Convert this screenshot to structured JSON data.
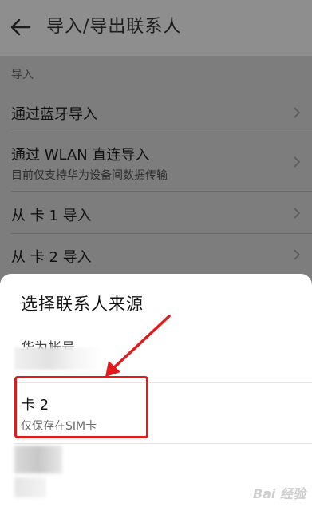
{
  "header": {
    "title": "导入/导出联系人"
  },
  "list": {
    "section_label": "导入",
    "items": [
      {
        "label": "通过蓝牙导入"
      },
      {
        "label": "通过 WLAN 直连导入",
        "sub": "目前仅支持华为设备间数据传输"
      },
      {
        "label": "从 卡 1 导入"
      },
      {
        "label": "从 卡 2 导入"
      }
    ]
  },
  "dialog": {
    "title": "选择联系人来源",
    "options": [
      {
        "label": "华为帐号"
      },
      {
        "label": "卡 2",
        "sub": "仅保存在SIM卡"
      }
    ]
  },
  "watermark": "Bai 经验",
  "colors": {
    "highlight": "#e11b1b"
  },
  "icons": {
    "back": "back-arrow-icon",
    "chevron": "chevron-right-icon"
  }
}
